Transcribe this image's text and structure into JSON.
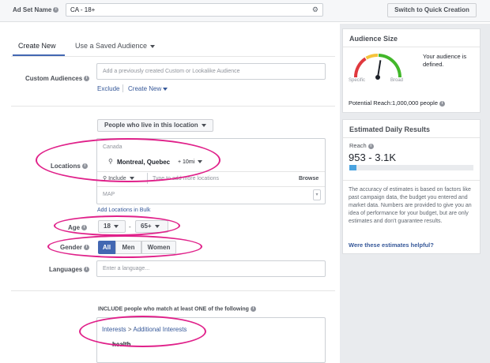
{
  "header": {
    "ad_set_label": "Ad Set Name",
    "ad_set_value": "CA - 18+",
    "quick_creation": "Switch to Quick Creation"
  },
  "tabs": {
    "create_new": "Create New",
    "saved_audience": "Use a Saved Audience"
  },
  "custom_audiences": {
    "label": "Custom Audiences",
    "placeholder": "Add a previously created Custom or Lookalike Audience",
    "exclude": "Exclude",
    "create_new": "Create New"
  },
  "locations": {
    "dropdown": "People who live in this location",
    "label": "Locations",
    "country": "Canada",
    "city": "Montreal, Quebec",
    "radius": "+ 10mi",
    "include": "Include",
    "type_placeholder": "Type to add more locations",
    "browse": "Browse",
    "map": "MAP",
    "bulk": "Add Locations in Bulk"
  },
  "age": {
    "label": "Age",
    "min": "18",
    "dash": "-",
    "max": "65+"
  },
  "gender": {
    "label": "Gender",
    "all": "All",
    "men": "Men",
    "women": "Women"
  },
  "languages": {
    "label": "Languages",
    "placeholder": "Enter a language..."
  },
  "detailed": {
    "include_text": "INCLUDE people who match at least ONE of the following",
    "path_interests": "Interests",
    "path_sep": ">",
    "path_additional": "Additional Interests",
    "item": "health"
  },
  "audience_size": {
    "title": "Audience Size",
    "defined": "Your audience is defined.",
    "specific": "Specific",
    "broad": "Broad",
    "potential_reach": "Potential Reach:1,000,000 people",
    "gauge_level": 0.55
  },
  "daily_results": {
    "title": "Estimated Daily Results",
    "reach_label": "Reach",
    "reach_value": "953 - 3.1K",
    "reach_bar_fraction": 0.06,
    "disclaimer": "The accuracy of estimates is based on factors like past campaign data, the budget you entered and market data. Numbers are provided to give you an idea of performance for your budget, but are only estimates and don't guarantee results.",
    "helpful_link": "Were these estimates helpful?"
  },
  "colors": {
    "accent_blue": "#4267b2",
    "highlight_pink": "#e0218a",
    "gauge_red": "#e0393e",
    "gauge_yellow": "#f5c33b",
    "gauge_green": "#42b72a"
  }
}
